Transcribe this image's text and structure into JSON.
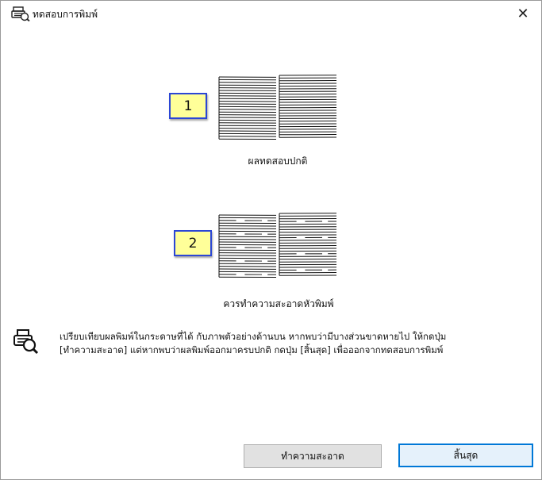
{
  "window": {
    "title": "ทดสอบการพิมพ์",
    "close_glyph": "✕"
  },
  "patterns": [
    {
      "badge": "1",
      "caption": "ผลทดสอบปกติ"
    },
    {
      "badge": "2",
      "caption": "ควรทำความสะอาดหัวพิมพ์"
    }
  ],
  "message": {
    "line1": "เปรียบเทียบผลพิมพ์ในกระดาษที่ได้ กับภาพตัวอย่างด้านบน หากพบว่ามีบางส่วนขาดหายไป ให้กดปุ่ม",
    "line2": "[ทำความสะอาด] แต่หากพบว่าผลพิมพ์ออกมาครบปกติ กดปุ่ม [สิ้นสุด] เพื่อออกจากทดสอบการพิมพ์"
  },
  "buttons": {
    "clean": "ทำความสะอาด",
    "finish": "สิ้นสุด"
  },
  "colors": {
    "badge_fill": "#ffff99",
    "badge_border": "#2b46d6",
    "default_button_border": "#0078d7"
  }
}
